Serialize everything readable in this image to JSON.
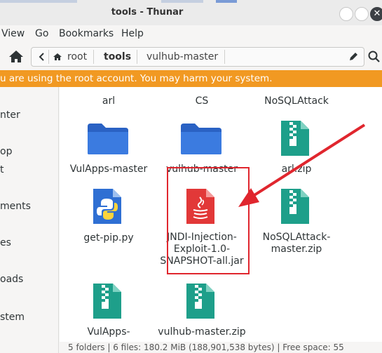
{
  "window": {
    "title": "tools - Thunar",
    "close_glyph": "✕"
  },
  "menu": [
    "View",
    "Go",
    "Bookmarks",
    "Help"
  ],
  "breadcrumbs": [
    "root",
    "tools",
    "vulhub-master"
  ],
  "warning": "u are using the root account. You may harm your system.",
  "sidebar": [
    "nter",
    "op",
    "t",
    "ments",
    "es",
    "oads",
    "stem"
  ],
  "files": [
    {
      "label": "arl",
      "icon": "none"
    },
    {
      "label": "CS",
      "icon": "none"
    },
    {
      "label": "NoSQLAttack",
      "icon": "none"
    },
    {
      "label": "VulApps-master",
      "icon": "folder-icon"
    },
    {
      "label": "vulhub-master",
      "icon": "folder-icon"
    },
    {
      "label": "arl.zip",
      "icon": "zip-icon"
    },
    {
      "label": "get-pip.py",
      "icon": "python-icon"
    },
    {
      "label": "JNDI-Injection-\nExploit-1.0-\nSNAPSHOT-all.jar",
      "icon": "java-icon"
    },
    {
      "label": "NoSQLAttack-\nmaster.zip",
      "icon": "zip-icon"
    },
    {
      "label": "VulApps-",
      "icon": "zip-icon"
    },
    {
      "label": "vulhub-master.zip",
      "icon": "zip-icon"
    }
  ],
  "status": "5 folders  |  6 files: 180.2 MiB (188,901,538 bytes)  |  Free space: 55",
  "colors": {
    "folder": "#2f6fd3",
    "zip": "#1e9f8a",
    "java": "#e23838",
    "warning": "#f19922",
    "annotation": "#e0262e"
  }
}
